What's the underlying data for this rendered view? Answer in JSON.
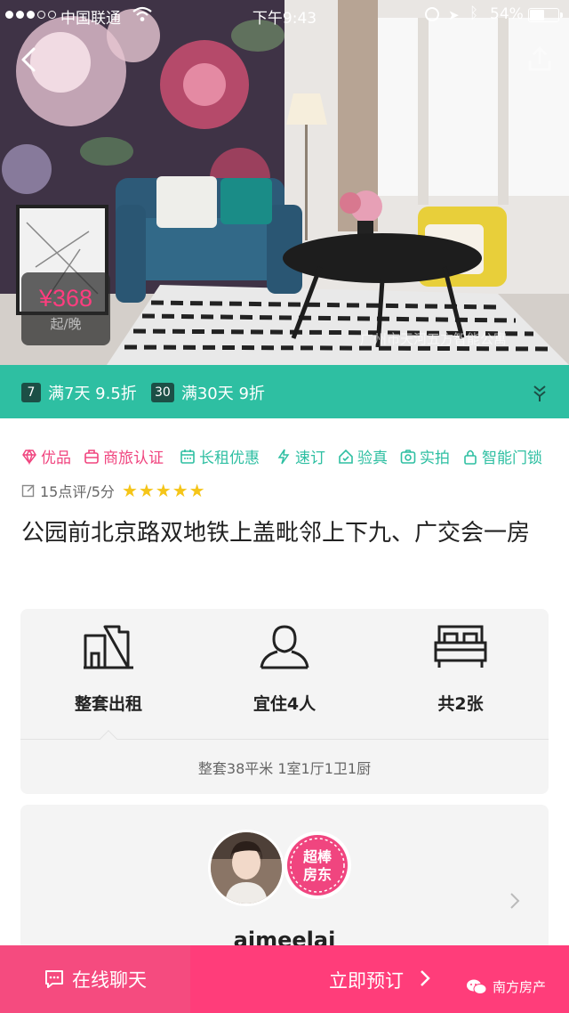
{
  "status_bar": {
    "carrier": "中国联通",
    "time": "下午9:43",
    "battery_pct": "54%",
    "battery_level": 0.54,
    "icons": [
      "signal-dots-icon",
      "wifi-icon",
      "rotation-lock-icon",
      "location-arrow-icon",
      "bluetooth-icon",
      "battery-icon"
    ]
  },
  "hero": {
    "price": "¥368",
    "price_unit": "起/晚",
    "watermark": "广州市天河五方智能公寓",
    "icons": [
      "back-arrow-icon",
      "share-icon"
    ]
  },
  "discounts": [
    {
      "days": "7",
      "text": "满7天 9.5折"
    },
    {
      "days": "30",
      "text": "满30天 9折"
    }
  ],
  "tags": [
    {
      "label": "优品",
      "icon": "diamond-icon",
      "color": "#f0457f"
    },
    {
      "label": "商旅认证",
      "icon": "briefcase-icon",
      "color": "#f0457f"
    },
    {
      "label": "长租优惠",
      "icon": "calendar-icon",
      "color": "#2ebfa2"
    },
    {
      "label": "速订",
      "icon": "lightning-icon",
      "color": "#2ebfa2"
    },
    {
      "label": "验真",
      "icon": "house-check-icon",
      "color": "#2ebfa2"
    },
    {
      "label": "实拍",
      "icon": "camera-icon",
      "color": "#2ebfa2"
    },
    {
      "label": "智能门锁",
      "icon": "lock-icon",
      "color": "#2ebfa2"
    }
  ],
  "rating": {
    "text": "15点评/5分",
    "stars": 5
  },
  "title": "公园前北京路双地铁上盖毗邻上下九、广交会一房",
  "features": [
    {
      "label": "整套出租",
      "icon": "building-icon"
    },
    {
      "label": "宜住4人",
      "icon": "person-icon"
    },
    {
      "label": "共2张",
      "icon": "bed-icon"
    }
  ],
  "area_text": "整套38平米  1室1厅1卫1厨",
  "host": {
    "name": "aimeelai",
    "badge": "超棒房东"
  },
  "bottom": {
    "chat_label": "在线聊天",
    "book_label": "立即预订",
    "source": "南方房产"
  },
  "colors": {
    "teal": "#2ebfa2",
    "pink": "#f0457f",
    "book_pink": "#ff3d7a"
  }
}
